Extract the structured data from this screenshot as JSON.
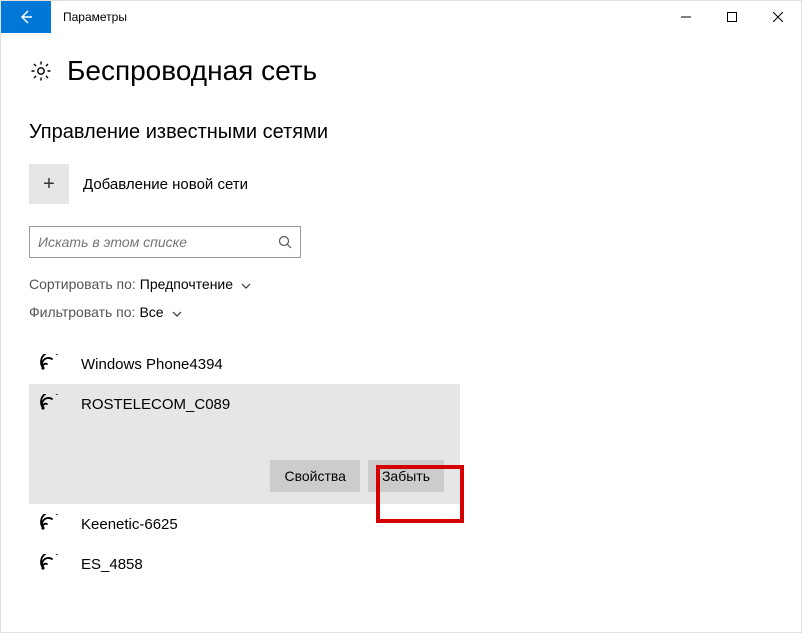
{
  "window": {
    "title": "Параметры"
  },
  "page": {
    "heading": "Беспроводная сеть",
    "section_title": "Управление известными сетями",
    "add_label": "Добавление новой сети",
    "search_placeholder": "Искать в этом списке",
    "sort": {
      "label": "Сортировать по:",
      "value": "Предпочтение"
    },
    "filter": {
      "label": "Фильтровать по:",
      "value": "Все"
    }
  },
  "networks": [
    {
      "name": "Windows Phone4394"
    },
    {
      "name": "ROSTELECOM_C089",
      "selected": true
    },
    {
      "name": "Keenetic-6625"
    },
    {
      "name": "ES_4858"
    }
  ],
  "actions": {
    "properties": "Свойства",
    "forget": "Забыть"
  }
}
